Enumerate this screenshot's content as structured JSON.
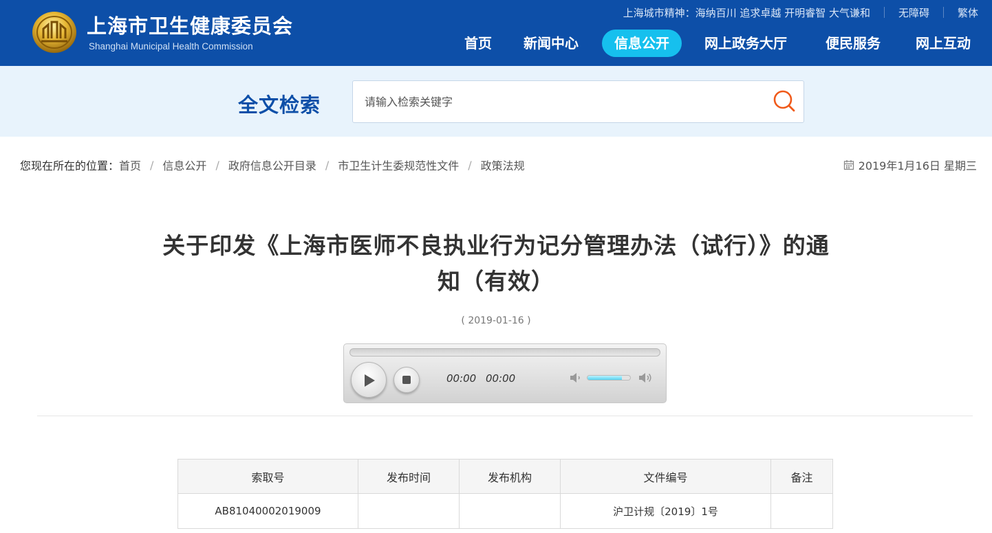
{
  "header": {
    "site_name": "上海市卫生健康委员会",
    "site_name_en": "Shanghai Municipal Health Commission",
    "spirit": "上海城市精神：海纳百川 追求卓越 开明睿智 大气谦和",
    "accessibility": "无障碍",
    "traditional": "繁体"
  },
  "nav": {
    "items": [
      {
        "label": "首页"
      },
      {
        "label": "新闻中心"
      },
      {
        "label": "信息公开",
        "active": true
      },
      {
        "label": "网上政务大厅"
      },
      {
        "label": "便民服务"
      },
      {
        "label": "网上互动"
      }
    ]
  },
  "search": {
    "title": "全文检索",
    "placeholder": "请输入检索关键字",
    "button_icon": "search-icon"
  },
  "breadcrumb": {
    "lead": "您现在所在的位置：",
    "items": [
      "首页",
      "信息公开",
      "政府信息公开目录",
      "市卫生计生委规范性文件",
      "政策法规"
    ]
  },
  "date_display": "2019年1月16日 星期三",
  "article": {
    "title_line1": "关于印发《上海市医师不良执业行为记分管理办法（试行）》的通",
    "title_line2": "知（有效）",
    "pub_date": "( 2019-01-16 )"
  },
  "player": {
    "current_time": "00:00",
    "duration": "00:00",
    "volume_level": 0.8
  },
  "table": {
    "headers": [
      "索取号",
      "发布时间",
      "发布机构",
      "文件编号",
      "备注"
    ],
    "rows": [
      [
        "AB81040002019009",
        "",
        "",
        "沪卫计规〔2019〕1号",
        ""
      ]
    ]
  },
  "colors": {
    "header_bg": "#0d4fa8",
    "nav_active": "#16c0ee",
    "search_band": "#e8f3fc",
    "search_icon": "#f05a1a"
  }
}
